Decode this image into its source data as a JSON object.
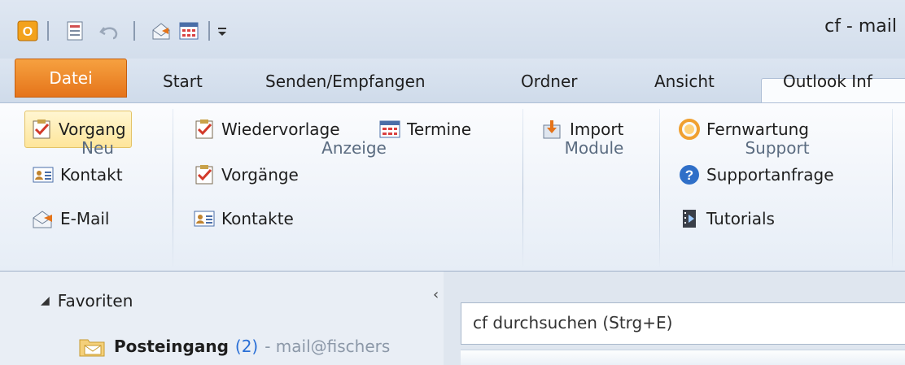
{
  "window": {
    "title": "cf - mail"
  },
  "quick_access": [
    "outlook-icon",
    "new-item-icon",
    "undo-icon",
    "send-receive-icon",
    "calendar-icon",
    "customize-icon"
  ],
  "tabs": {
    "file": "Datei",
    "start": "Start",
    "send_receive": "Senden/Empfangen",
    "folder": "Ordner",
    "view": "Ansicht",
    "addin": "Outlook Inf"
  },
  "ribbon": {
    "neu": {
      "label": "Neu",
      "items": [
        "Vorgang",
        "Kontakt",
        "E-Mail"
      ]
    },
    "anzeige": {
      "label": "Anzeige",
      "items": [
        "Wiedervorlage",
        "Termine",
        "Vorgänge",
        "Kontakte"
      ]
    },
    "module": {
      "label": "Module",
      "items": [
        "Import"
      ]
    },
    "support": {
      "label": "Support",
      "items": [
        "Fernwartung",
        "Supportanfrage",
        "Tutorials"
      ]
    }
  },
  "nav": {
    "favorites_label": "Favoriten",
    "inbox_label": "Posteingang",
    "inbox_count": "(2)",
    "inbox_account": "- mail@fischers",
    "collapse_glyph": "‹"
  },
  "search": {
    "placeholder": "cf durchsuchen (Strg+E)"
  },
  "colors": {
    "file_tab": "#e5741a",
    "highlight": "#fee59a",
    "link_count": "#2a6fd6"
  }
}
